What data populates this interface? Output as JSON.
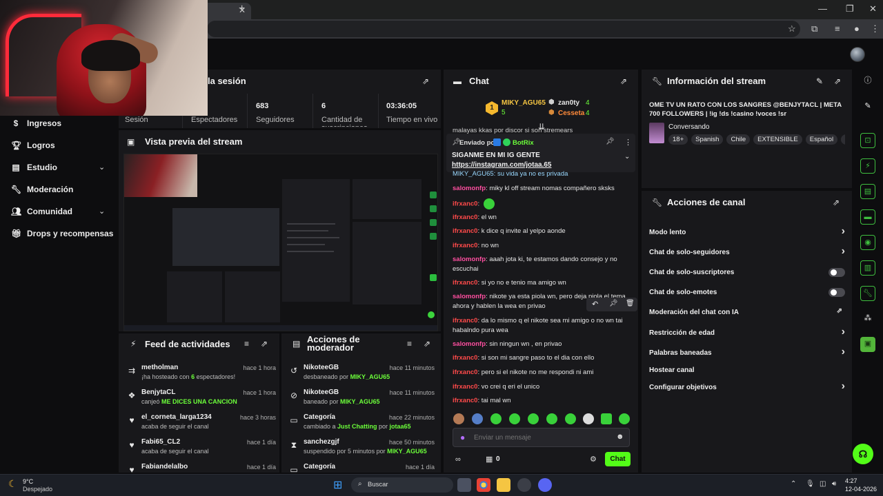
{
  "browser": {
    "tab_close": "✕",
    "new_tab": "+",
    "minimize": "—",
    "maximize": "❐",
    "close": "✕"
  },
  "nav": {
    "items": [
      {
        "label": "Ingresos",
        "icon": "dollar-icon"
      },
      {
        "label": "Logros",
        "icon": "trophy-icon"
      },
      {
        "label": "Estudio",
        "icon": "studio-icon"
      },
      {
        "label": "Moderación",
        "icon": "wrench-icon"
      },
      {
        "label": "Comunidad",
        "icon": "community-icon"
      },
      {
        "label": "Drops y recompensas",
        "icon": "gift-icon"
      }
    ]
  },
  "stats": {
    "title": "la sesión",
    "cells": [
      {
        "value": "",
        "label": "Sesión"
      },
      {
        "value": "",
        "label": "Espectadores"
      },
      {
        "value": "683",
        "label": "Seguidores"
      },
      {
        "value": "6",
        "label": "Cantidad de suscripciones"
      },
      {
        "value": "03:36:05",
        "label": "Tiempo en vivo"
      }
    ]
  },
  "preview": {
    "title": "Vista previa del stream"
  },
  "feed": {
    "title": "Feed de actividades",
    "items": [
      {
        "name": "metholman",
        "pre": "¡ha hosteado con ",
        "hl": "6",
        "post": " espectadores!",
        "time": "hace 1 hora",
        "icon": "host-icon"
      },
      {
        "name": "BenjytaCL",
        "pre": "canjeó ",
        "hl": "ME DICES UNA CANCION",
        "post": "",
        "time": "hace 1 hora",
        "icon": "reward-icon"
      },
      {
        "name": "el_corneta_larga1234",
        "pre": "acaba de seguir el canal",
        "hl": "",
        "post": "",
        "time": "hace 3 horas",
        "icon": "heart-icon"
      },
      {
        "name": "Fabi65_CL2",
        "pre": "acaba de seguir el canal",
        "hl": "",
        "post": "",
        "time": "hace 1 día",
        "icon": "heart-icon"
      },
      {
        "name": "Fabiandelalbo",
        "pre": "",
        "hl": "",
        "post": "",
        "time": "hace 1 día",
        "icon": "heart-icon"
      }
    ]
  },
  "modactions": {
    "title": "Acciones de moderador",
    "items": [
      {
        "name": "NikoteeGB",
        "pre": "desbaneado por ",
        "hl": "MIKY_AGU65",
        "mid": "",
        "hl2": "",
        "time": "hace 11 minutos",
        "icon": "unban-icon"
      },
      {
        "name": "NikoteeGB",
        "pre": "baneado por ",
        "hl": "MIKY_AGU65",
        "mid": "",
        "hl2": "",
        "time": "hace 11 minutos",
        "icon": "ban-icon"
      },
      {
        "name": "Categoría",
        "pre": "cambiado a ",
        "hl": "Just Chatting",
        "mid": " por ",
        "hl2": "jotaa65",
        "time": "hace 22 minutos",
        "icon": "category-icon"
      },
      {
        "name": "sanchezgjf",
        "pre": "suspendido por 5 minutos por ",
        "hl": "MIKY_AGU65",
        "mid": "",
        "hl2": "",
        "time": "hace 50 minutos",
        "icon": "hourglass-icon"
      },
      {
        "name": "Categoría",
        "pre": "",
        "hl": "",
        "mid": "",
        "hl2": "",
        "time": "hace 1 día",
        "icon": "category-icon"
      }
    ]
  },
  "chat": {
    "title": "Chat",
    "leaders": [
      {
        "rank": "1",
        "name": "MIKY_AGU65",
        "count": "5"
      },
      {
        "name": "zan0ty",
        "count": "4"
      },
      {
        "name": "Cesseta",
        "count": "4"
      }
    ],
    "top_fragment": "malayas kkas por discor si son stremears",
    "pinned": {
      "sent_label": "Enviado por",
      "sender": "BotRix",
      "message": "SIGANME EN MI IG GENTE",
      "link": "https://instagram.com/jotaa.65"
    },
    "under_pinned": "MIKY_AGU65: su vida ya no es privada",
    "messages": [
      {
        "user": "salomonfp",
        "color": "pink",
        "text": "miky kl off stream nomas compañero sksks"
      },
      {
        "user": "ifrxanc0",
        "color": "red",
        "text": ""
      },
      {
        "user": "ifrxanc0",
        "color": "red",
        "text": "el wn"
      },
      {
        "user": "ifrxanc0",
        "color": "red",
        "text": "k dice q invite al yelpo aonde"
      },
      {
        "user": "ifrxanc0",
        "color": "red",
        "text": "no wn"
      },
      {
        "user": "salomonfp",
        "color": "pink",
        "text": "aaah jota ki, te estamos dando consejo y no escuchai"
      },
      {
        "user": "ifrxanc0",
        "color": "red",
        "text": "si yo no e tenio ma amigo wn"
      },
      {
        "user": "salomonfp",
        "color": "pink",
        "text": "nikote ya esta piola wn, pero deja piola el tema ahora y hablen la wea en privao"
      },
      {
        "user": "ifrxanc0",
        "color": "red",
        "text": "da lo mismo q el nikote sea mi amigo o no wn tai habalndo pura wea"
      },
      {
        "user": "salomonfp",
        "color": "pink",
        "text": "sin ningun wn , en privao"
      },
      {
        "user": "ifrxanc0",
        "color": "red",
        "text": "si son mi sangre paso to el dia con ello"
      },
      {
        "user": "ifrxanc0",
        "color": "red",
        "text": "pero si el nikote no me respondi ni ami"
      },
      {
        "user": "ifrxanc0",
        "color": "red",
        "text": "vo crei q eri el unico"
      },
      {
        "user": "ifrxanc0",
        "color": "red",
        "text": "tai mal wn"
      }
    ],
    "placeholder": "Enviar un mensaje",
    "points": "0",
    "send_label": "Chat"
  },
  "info": {
    "title": "Información del stream",
    "stream_title": "OME TV UN RATO CON LOS SANGRES @BENJYTACL | META 700 FOLLOWERS | !ig !ds !casino !voces !sr",
    "category": "Conversando",
    "tags": [
      "18+",
      "Spanish",
      "Chile",
      "EXTENSIBLE",
      "Español",
      "c"
    ]
  },
  "channel_actions": {
    "title": "Acciones de canal",
    "items": [
      {
        "label": "Modo lento",
        "control": "arrow"
      },
      {
        "label": "Chat de solo-seguidores",
        "control": "arrow"
      },
      {
        "label": "Chat de solo-suscriptores",
        "control": "toggle"
      },
      {
        "label": "Chat de solo-emotes",
        "control": "toggle"
      },
      {
        "label": "Moderación del chat con IA",
        "control": "external"
      },
      {
        "label": "Restricción de edad",
        "control": "arrow"
      },
      {
        "label": "Palabras baneadas",
        "control": "arrow"
      },
      {
        "label": "Hostear canal",
        "control": "none"
      },
      {
        "label": "Configurar objetivos",
        "control": "arrow"
      }
    ]
  },
  "taskbar": {
    "weather_temp": "9°C",
    "weather_desc": "Despejado",
    "search": "Buscar",
    "time": "4:27",
    "date": "12-04-2026"
  }
}
